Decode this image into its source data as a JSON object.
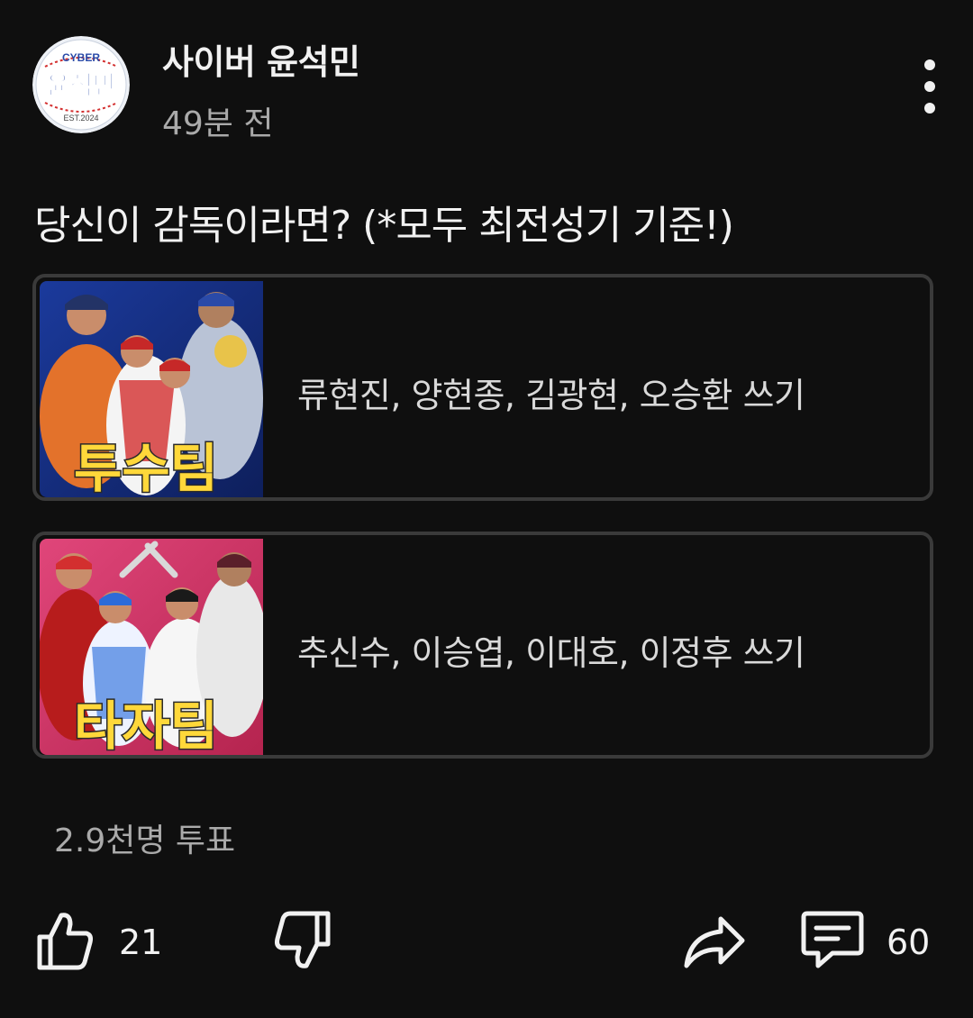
{
  "header": {
    "channel_name": "사이버 윤석민",
    "time_ago": "49분 전",
    "avatar_logo": {
      "top_text": "CYBER",
      "main_text": "윤석민",
      "bottom_text": "EST.2024"
    }
  },
  "poll": {
    "question": "당신이 감독이라면? (*모두 최전성기 기준!)",
    "options": [
      {
        "label": "류현진, 양현종, 김광현, 오승환 쓰기",
        "thumbnail_caption": "투수팀",
        "thumbnail_bg": "#1d3a8a"
      },
      {
        "label": "추신수, 이승엽, 이대호, 이정후 쓰기",
        "thumbnail_caption": "타자팀",
        "thumbnail_bg": "#d63a6e"
      }
    ],
    "vote_count": "2.9천명 투표"
  },
  "actions": {
    "like_count": "21",
    "comment_count": "60"
  },
  "colors": {
    "background": "#0f0f0f",
    "text_primary": "#f1f1f1",
    "text_secondary": "#aaaaaa",
    "option_border": "#3a3a3a",
    "thumbnail_caption": "#ffd83a"
  },
  "icons": {
    "more": "more-vert-icon",
    "like": "thumbs-up-icon",
    "dislike": "thumbs-down-icon",
    "share": "share-icon",
    "comment": "comment-icon"
  }
}
